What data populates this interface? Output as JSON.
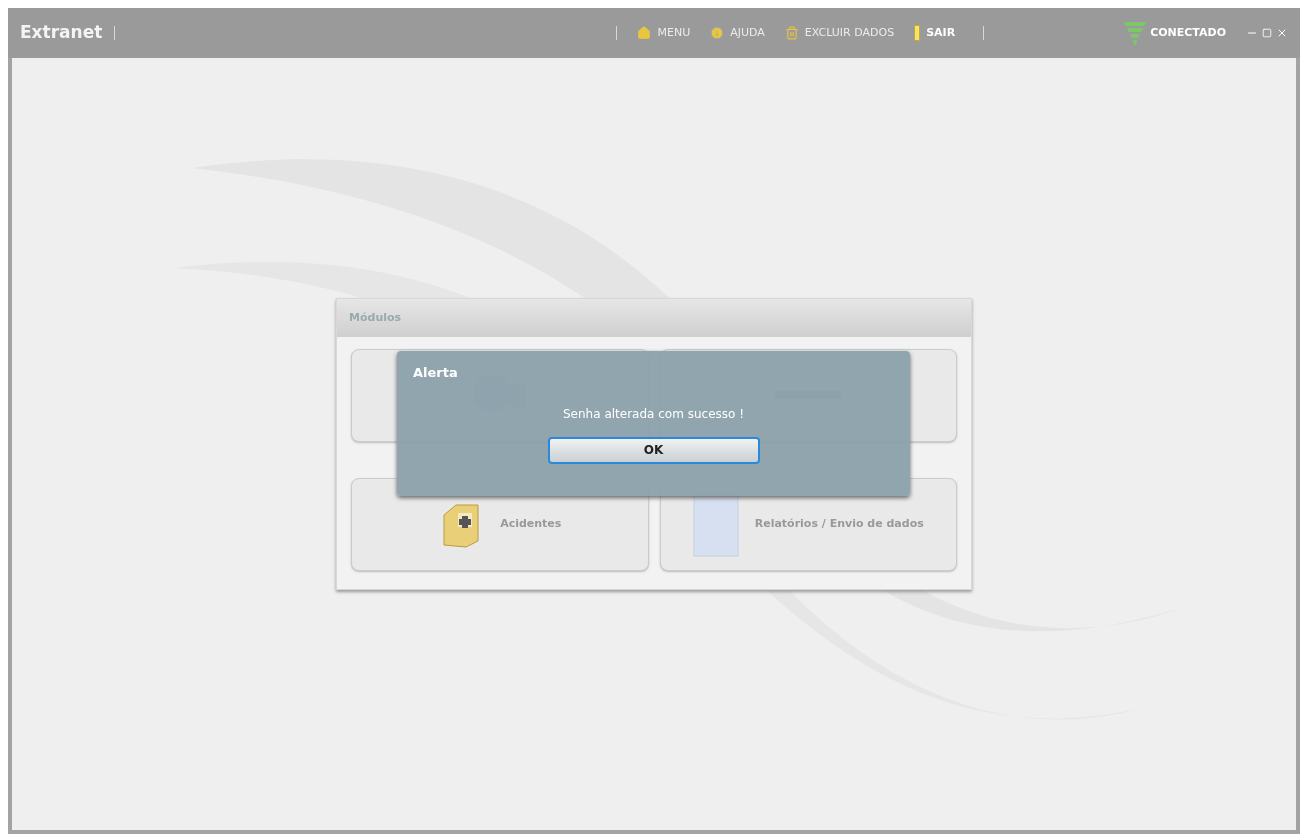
{
  "app": {
    "title": "Extranet"
  },
  "menu": [
    {
      "kind": "home",
      "label": "MENU",
      "disabled": true
    },
    {
      "kind": "help",
      "label": "AJUDA",
      "disabled": true
    },
    {
      "kind": "trash",
      "label": "EXCLUIR DADOS",
      "disabled": true
    },
    {
      "kind": "exit",
      "label": "SAIR",
      "disabled": false
    }
  ],
  "status": {
    "label": "CONECTADO"
  },
  "modules": {
    "title": "Módulos",
    "tiles": [
      {
        "kind": "people"
      },
      {
        "kind": "transport"
      },
      {
        "kind": "firstaid",
        "label": "Acidentes"
      },
      {
        "kind": "report",
        "label": "Relatórios / Envio de dados"
      }
    ]
  },
  "alert": {
    "title": "Alerta",
    "message": "Senha alterada com sucesso !",
    "button": "OK"
  }
}
